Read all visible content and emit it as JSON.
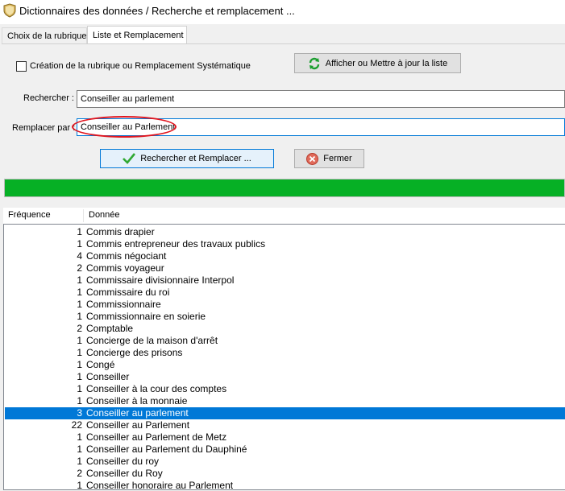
{
  "window": {
    "title": "Dictionnaires des données / Recherche et remplacement ..."
  },
  "tabs": [
    {
      "label": "Choix de la rubrique",
      "active": false
    },
    {
      "label": "Liste et Remplacement",
      "active": true
    }
  ],
  "options": {
    "systematic_label": "Création de la rubrique ou Remplacement Systématique",
    "systematic_checked": false
  },
  "buttons": {
    "refresh_label": "Afficher ou Mettre à jour la liste",
    "replace_label": "Rechercher et Remplacer ...",
    "close_label": "Fermer"
  },
  "search": {
    "label": "Rechercher :",
    "value": "Conseiller au parlement"
  },
  "replace": {
    "label": "Remplacer par :",
    "value": "Conseiller au Parlement"
  },
  "progress": {
    "percent": 100,
    "color": "#06b025"
  },
  "list": {
    "columns": {
      "frequency": "Fréquence",
      "data": "Donnée"
    },
    "selected_index": 15,
    "rows": [
      {
        "freq": "1",
        "value": "Commis drapier"
      },
      {
        "freq": "1",
        "value": "Commis entrepreneur des travaux publics"
      },
      {
        "freq": "4",
        "value": "Commis négociant"
      },
      {
        "freq": "2",
        "value": "Commis voyageur"
      },
      {
        "freq": "1",
        "value": "Commissaire divisionnaire Interpol"
      },
      {
        "freq": "1",
        "value": "Commissaire du roi"
      },
      {
        "freq": "1",
        "value": "Commissionnaire"
      },
      {
        "freq": "1",
        "value": "Commissionnaire en soierie"
      },
      {
        "freq": "2",
        "value": "Comptable"
      },
      {
        "freq": "1",
        "value": "Concierge de la maison d'arrêt"
      },
      {
        "freq": "1",
        "value": "Concierge des prisons"
      },
      {
        "freq": "1",
        "value": "Congé"
      },
      {
        "freq": "1",
        "value": "Conseiller"
      },
      {
        "freq": "1",
        "value": "Conseiller à la cour des comptes"
      },
      {
        "freq": "1",
        "value": "Conseiller à la monnaie"
      },
      {
        "freq": "3",
        "value": "Conseiller au parlement"
      },
      {
        "freq": "22",
        "value": "Conseiller au Parlement"
      },
      {
        "freq": "1",
        "value": "Conseiller au Parlement de Metz"
      },
      {
        "freq": "1",
        "value": "Conseiller au Parlement du Dauphiné"
      },
      {
        "freq": "1",
        "value": "Conseiller du roy"
      },
      {
        "freq": "2",
        "value": "Conseiller du Roy"
      },
      {
        "freq": "1",
        "value": "Conseiller honoraire au Parlement"
      }
    ]
  },
  "colors": {
    "selection": "#0078d7",
    "annotation": "#e0141e",
    "accent_border": "#0078d7"
  }
}
